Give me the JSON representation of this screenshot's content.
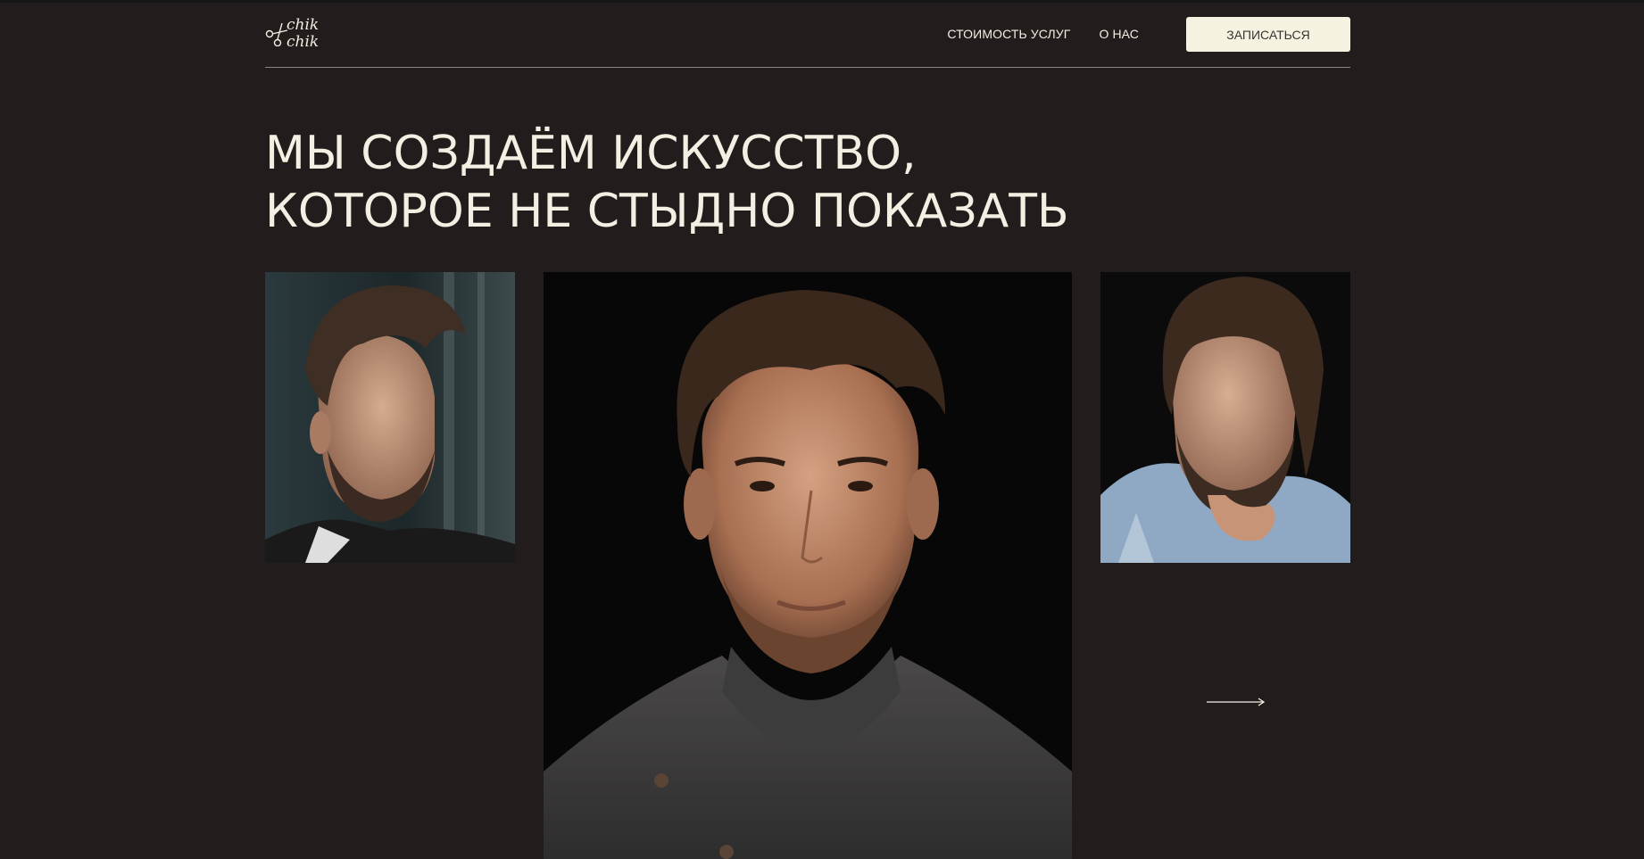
{
  "brand": {
    "logo_text": "chik\nchik",
    "logo_icon": "scissors-icon"
  },
  "nav": {
    "items": [
      {
        "label": "СТОИМОСТЬ УСЛУГ"
      },
      {
        "label": "О НАС"
      }
    ],
    "cta_label": "ЗАПИСАТЬСЯ"
  },
  "hero": {
    "title_line1": "МЫ СОЗДАЁМ ИСКУССТВО,",
    "title_line2": "КОТОРОЕ НЕ СТЫДНО ПОКАЗАТЬ"
  },
  "gallery": {
    "images": [
      {
        "name": "portrait-man-fade-beard"
      },
      {
        "name": "portrait-man-curly-hair-sweater"
      },
      {
        "name": "portrait-man-long-hair-beard"
      }
    ],
    "next_icon": "arrow-right-icon"
  },
  "colors": {
    "background": "#231c1c",
    "text": "#f3efe2",
    "cta_background": "#f6f2e1",
    "cta_text": "#3a3331",
    "divider": "#8d8782"
  }
}
